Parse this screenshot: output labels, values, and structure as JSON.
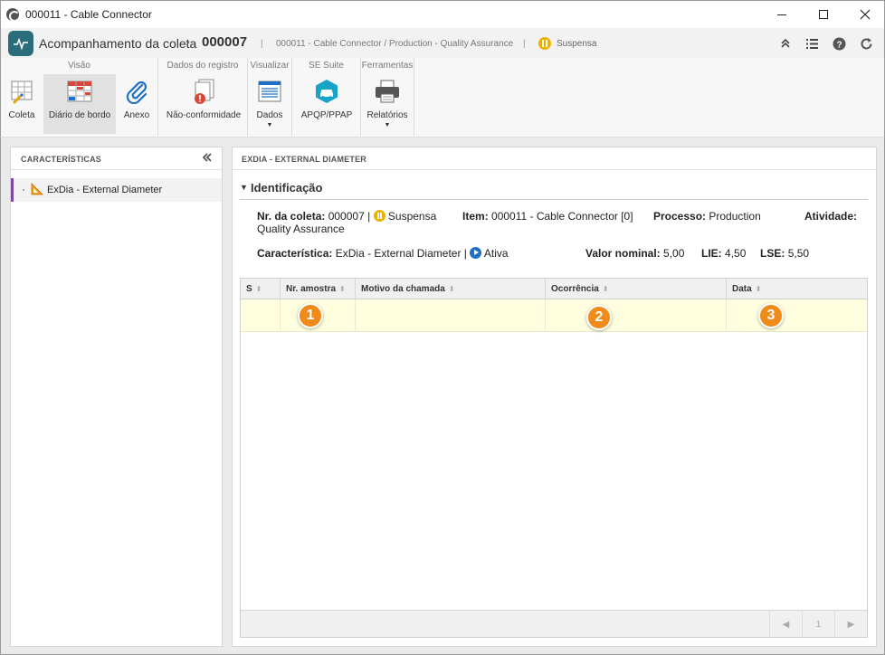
{
  "window": {
    "title": "000011 - Cable Connector"
  },
  "header": {
    "title": "Acompanhamento da coleta",
    "chevron": "›",
    "code": "000007",
    "sep": "|",
    "path": "000011 - Cable Connector / Production - Quality Assurance",
    "status": "Suspensa"
  },
  "ribbon": {
    "groups": {
      "visao": "Visão",
      "dados_registro": "Dados do registro",
      "visualizar": "Visualizar",
      "se_suite": "SE Suite",
      "ferramentas": "Ferramentas"
    },
    "buttons": {
      "coleta": "Coleta",
      "diario": "Diário de bordo",
      "anexo": "Anexo",
      "nao_conformidade": "Não-conformidade",
      "dados": "Dados",
      "apqp": "APQP/PPAP",
      "relatorios": "Relatórios"
    }
  },
  "left_panel": {
    "title": "CARACTERÍSTICAS",
    "items": [
      {
        "label": "ExDia - External Diameter"
      }
    ]
  },
  "right_panel": {
    "title": "EXDIA - EXTERNAL DIAMETER",
    "section_title": "Identificação",
    "fields": {
      "nr_coleta_label": "Nr. da coleta:",
      "nr_coleta_value": "000007 |",
      "status_value": "Suspensa",
      "item_label": "Item:",
      "item_value": "000011 - Cable Connector [0]",
      "processo_label": "Processo:",
      "processo_value": "Production",
      "atividade_label": "Atividade:",
      "atividade_value": "Quality Assurance",
      "caracteristica_label": "Característica:",
      "caracteristica_value": "ExDia - External Diameter |",
      "caracteristica_status": "Ativa",
      "valor_nominal_label": "Valor nominal:",
      "valor_nominal_value": "5,00",
      "lie_label": "LIE:",
      "lie_value": "4,50",
      "lse_label": "LSE:",
      "lse_value": "5,50"
    },
    "grid": {
      "columns": [
        "S",
        "Nr. amostra",
        "Motivo da chamada",
        "Ocorrência",
        "Data"
      ],
      "badges": [
        "1",
        "2",
        "3"
      ],
      "pager": {
        "prev": "◀",
        "page": "1",
        "next": "▶"
      }
    }
  },
  "colors": {
    "brand": "#2b6c7a",
    "status_suspended": "#e8b400",
    "status_active": "#1e6fc6",
    "badge": "#f08a18",
    "row_highlight": "#ffffdf",
    "selected_marker": "#7b4aa0"
  }
}
